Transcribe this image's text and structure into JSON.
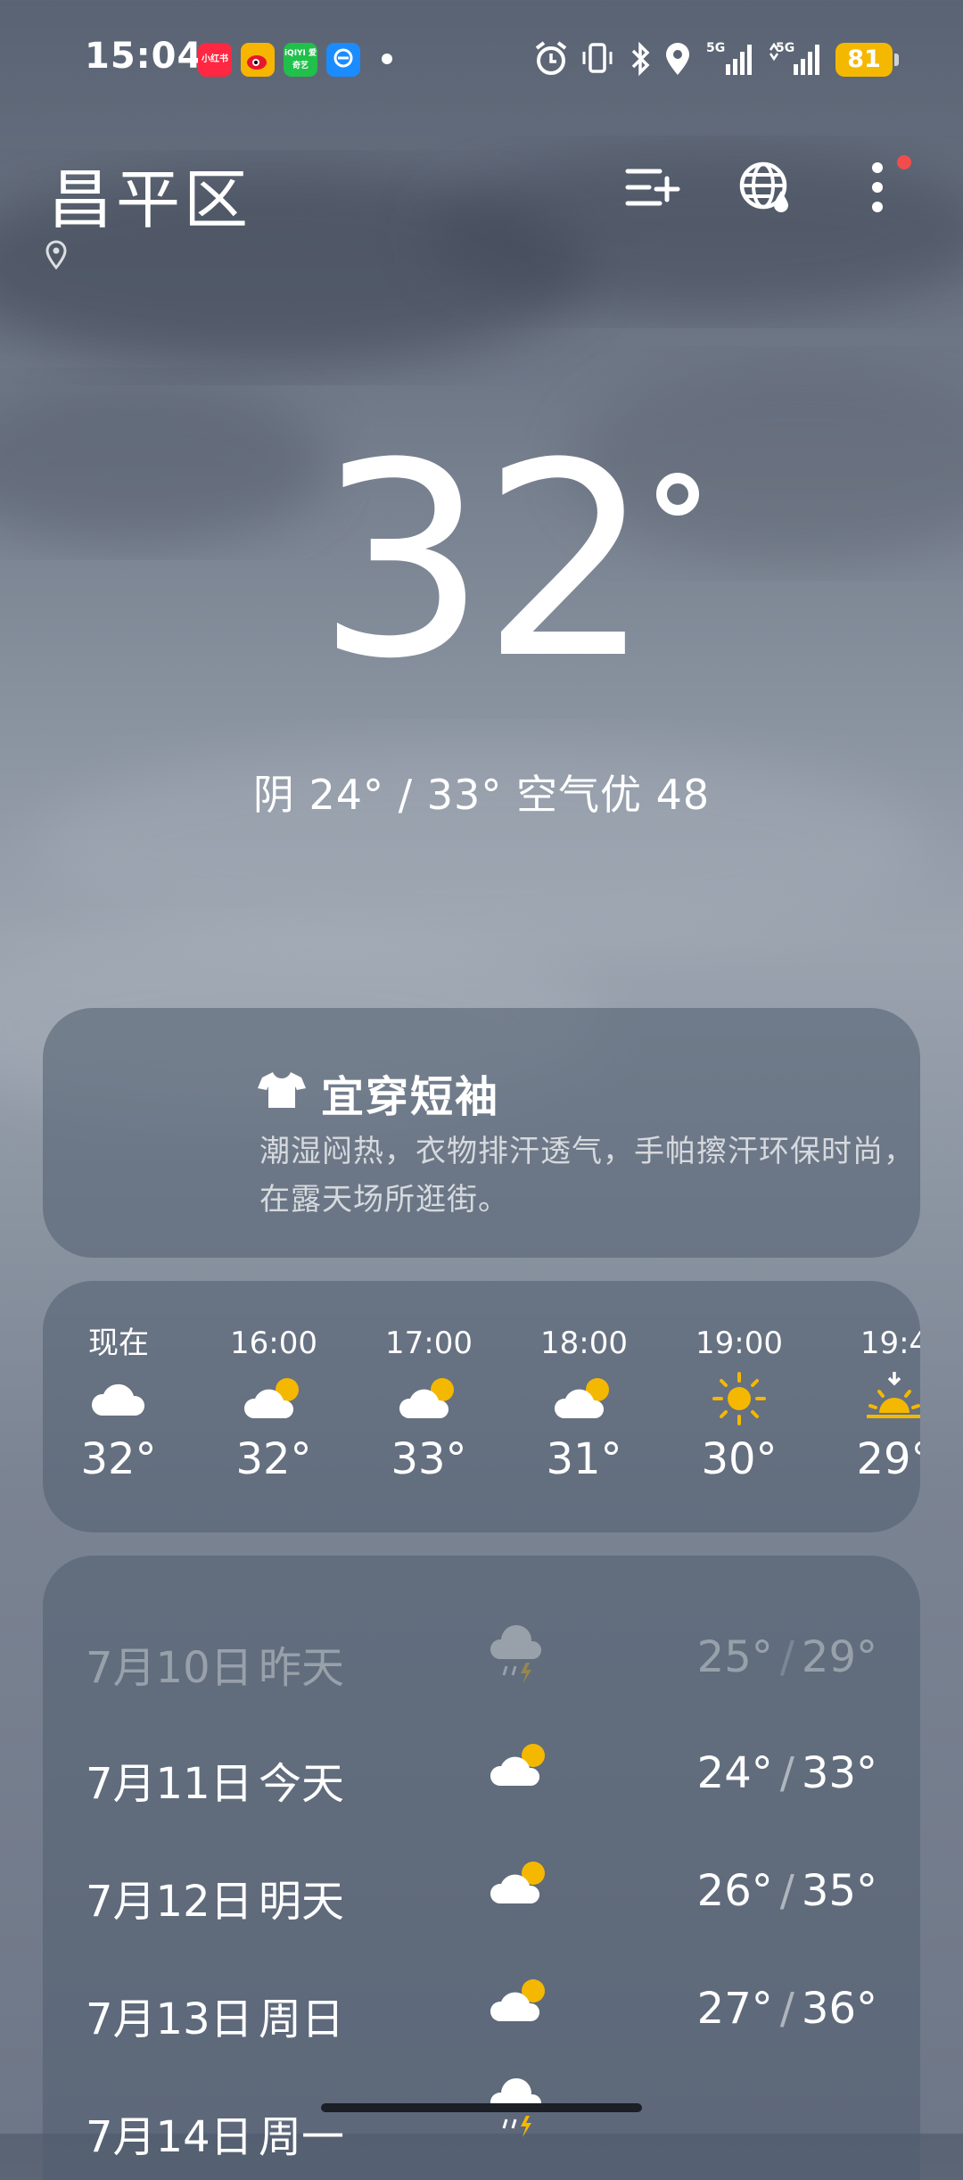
{
  "status_bar": {
    "time": "15:04",
    "apps": [
      {
        "name": "xiaohongshu",
        "label": "小红书",
        "color": "#ff2741"
      },
      {
        "name": "weibo",
        "label": "微博",
        "color": "#f7b500"
      },
      {
        "name": "iqiyi",
        "label": "iQIYI 爱奇艺",
        "color": "#21c04b"
      },
      {
        "name": "eleme",
        "label": "饿了么",
        "color": "#1a8cff"
      }
    ],
    "signal1": "5G",
    "signal2": "5G",
    "battery": "81"
  },
  "header": {
    "city": "昌平区",
    "accent_dot_color": "#f14d4d"
  },
  "current": {
    "temperature": "32",
    "summary": "阴  24° / 33°  空气优 48"
  },
  "advice": {
    "title": "宜穿短袖",
    "text": "潮湿闷热，衣物排汗透气，手帕擦汗环保时尚，在露天场所逛街。"
  },
  "hourly": [
    {
      "time": "现在",
      "icon": "cloudy-icon",
      "temp": "32°"
    },
    {
      "time": "16:00",
      "icon": "partly-cloudy-icon",
      "temp": "32°"
    },
    {
      "time": "17:00",
      "icon": "partly-cloudy-icon",
      "temp": "33°"
    },
    {
      "time": "18:00",
      "icon": "partly-cloudy-icon",
      "temp": "31°"
    },
    {
      "time": "19:00",
      "icon": "sunny-icon",
      "temp": "30°"
    },
    {
      "time": "19:4",
      "icon": "sunset-icon",
      "temp": "29°"
    }
  ],
  "daily": [
    {
      "date": "7月10日",
      "label": "昨天",
      "icon": "thunderstorm-icon",
      "low": "25°",
      "high": "29°",
      "faded": true
    },
    {
      "date": "7月11日",
      "label": "今天",
      "icon": "partly-cloudy-icon",
      "low": "24°",
      "high": "33°"
    },
    {
      "date": "7月12日",
      "label": "明天",
      "icon": "partly-cloudy-icon",
      "low": "26°",
      "high": "35°"
    },
    {
      "date": "7月13日",
      "label": "周日",
      "icon": "partly-cloudy-icon",
      "low": "27°",
      "high": "36°"
    },
    {
      "date": "7月14日",
      "label": "周一",
      "icon": "thunderstorm-icon",
      "low": "",
      "high": ""
    }
  ]
}
